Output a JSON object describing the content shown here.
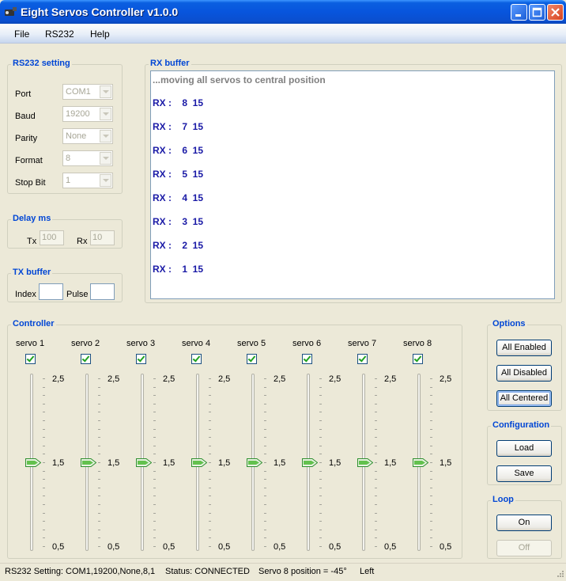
{
  "window": {
    "title": "Eight Servos Controller v1.0.0",
    "titlebar_color": "#0855dd"
  },
  "menu": [
    "File",
    "RS232",
    "Help"
  ],
  "rs232": {
    "title": "RS232 setting",
    "fields": [
      {
        "label": "Port",
        "value": "COM1"
      },
      {
        "label": "Baud",
        "value": "19200"
      },
      {
        "label": "Parity",
        "value": "None"
      },
      {
        "label": "Format",
        "value": "8"
      },
      {
        "label": "Stop Bit",
        "value": "1"
      }
    ]
  },
  "delay": {
    "title": "Delay ms",
    "tx_label": "Tx",
    "tx_value": "100",
    "rx_label": "Rx",
    "rx_value": "10"
  },
  "tx_buffer": {
    "title": "TX buffer",
    "index_label": "Index",
    "index_value": "",
    "pulse_label": "Pulse",
    "pulse_value": ""
  },
  "rx_buffer": {
    "title": "RX buffer",
    "header": "...moving all servos to central position",
    "lines": [
      "RX :    8  15",
      "RX :    7  15",
      "RX :    6  15",
      "RX :    5  15",
      "RX :    4  15",
      "RX :    3  15",
      "RX :    2  15",
      "RX :    1  15"
    ]
  },
  "controller": {
    "title": "Controller",
    "scale_top": "2,5",
    "scale_mid": "1,5",
    "scale_bottom": "0,5",
    "servos": [
      {
        "label": "servo 1",
        "enabled": true,
        "value": 1.5
      },
      {
        "label": "servo 2",
        "enabled": true,
        "value": 1.5
      },
      {
        "label": "servo 3",
        "enabled": true,
        "value": 1.5
      },
      {
        "label": "servo 4",
        "enabled": true,
        "value": 1.5
      },
      {
        "label": "servo 5",
        "enabled": true,
        "value": 1.5
      },
      {
        "label": "servo 6",
        "enabled": true,
        "value": 1.5
      },
      {
        "label": "servo 7",
        "enabled": true,
        "value": 1.5
      },
      {
        "label": "servo 8",
        "enabled": true,
        "value": 1.5
      }
    ]
  },
  "options": {
    "title": "Options",
    "all_enabled": "All Enabled",
    "all_disabled": "All Disabled",
    "all_centered": "All Centered"
  },
  "configuration": {
    "title": "Configuration",
    "load": "Load",
    "save": "Save"
  },
  "loop": {
    "title": "Loop",
    "on": "On",
    "off": "Off"
  },
  "status": {
    "setting": "RS232 Setting: COM1,19200,None,8,1",
    "connection": "Status: CONNECTED",
    "servo_position": "Servo 8 position = -45°",
    "direction": "Left"
  }
}
